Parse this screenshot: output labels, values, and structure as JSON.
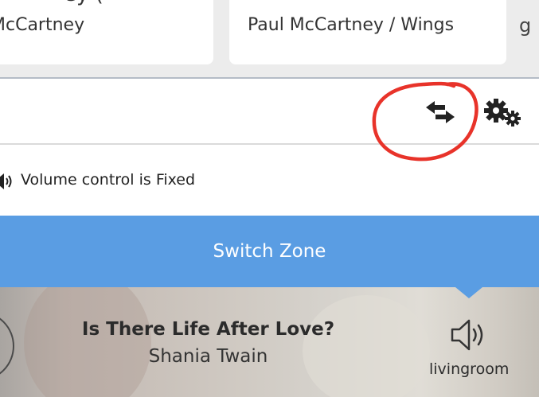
{
  "zone_cards": [
    {
      "top_text": "ey (",
      "subtitle": "McCartney"
    },
    {
      "subtitle": "Paul McCartney / Wings"
    }
  ],
  "peek_card": {
    "text": "g"
  },
  "panel": {
    "volume_status": "Volume control is Fixed"
  },
  "icons": {
    "swap": "swap-arrows-icon",
    "settings": "gears-icon",
    "volume": "speaker-icon"
  },
  "annotation": {
    "color": "#e8332a"
  },
  "switch_zone_label": "Switch Zone",
  "now_playing": {
    "title": "Is There Life After Love?",
    "artist": "Shania Twain",
    "zone": "livingroom"
  },
  "colors": {
    "accent": "#5a9de3",
    "text": "#222222"
  }
}
